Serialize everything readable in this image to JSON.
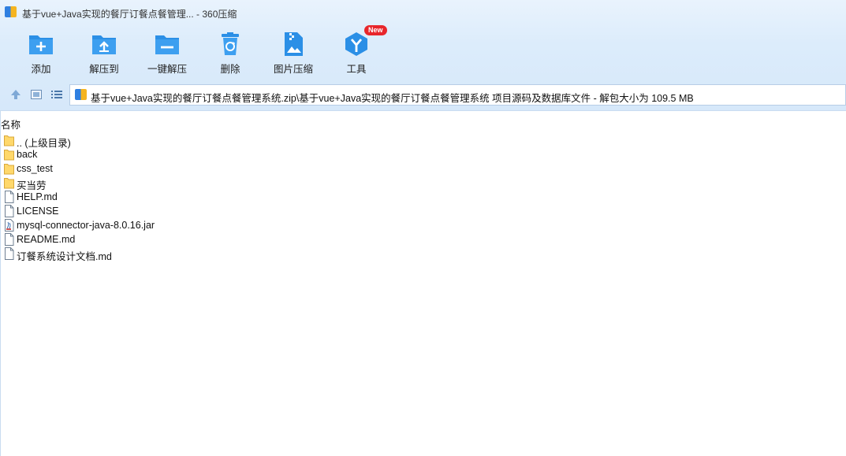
{
  "window": {
    "title": "基于vue+Java实现的餐厅订餐点餐管理... - 360压缩"
  },
  "toolbar": {
    "items": [
      {
        "label": "添加",
        "icon": "add-folder-icon"
      },
      {
        "label": "解压到",
        "icon": "extract-to-icon"
      },
      {
        "label": "一键解压",
        "icon": "one-click-extract-icon"
      },
      {
        "label": "删除",
        "icon": "delete-icon"
      },
      {
        "label": "图片压缩",
        "icon": "image-compress-icon"
      },
      {
        "label": "工具",
        "icon": "tools-icon",
        "badge": "New"
      }
    ]
  },
  "address": {
    "path": "基于vue+Java实现的餐厅订餐点餐管理系统.zip\\基于vue+Java实现的餐厅订餐点餐管理系统 项目源码及数据库文件 - 解包大小为 109.5 MB"
  },
  "list": {
    "header": "名称",
    "files": [
      {
        "name": ".. (上级目录)",
        "type": "folder"
      },
      {
        "name": "back",
        "type": "folder"
      },
      {
        "name": "css_test",
        "type": "folder"
      },
      {
        "name": "买当劳",
        "type": "folder"
      },
      {
        "name": "HELP.md",
        "type": "file"
      },
      {
        "name": "LICENSE",
        "type": "file"
      },
      {
        "name": "mysql-connector-java-8.0.16.jar",
        "type": "jar"
      },
      {
        "name": "README.md",
        "type": "file"
      },
      {
        "name": "订餐系统设计文档.md",
        "type": "file"
      }
    ]
  },
  "colors": {
    "accent": "#2b8fe6",
    "toolbar_bg": "#dcecfb",
    "badge": "#e8262b"
  }
}
